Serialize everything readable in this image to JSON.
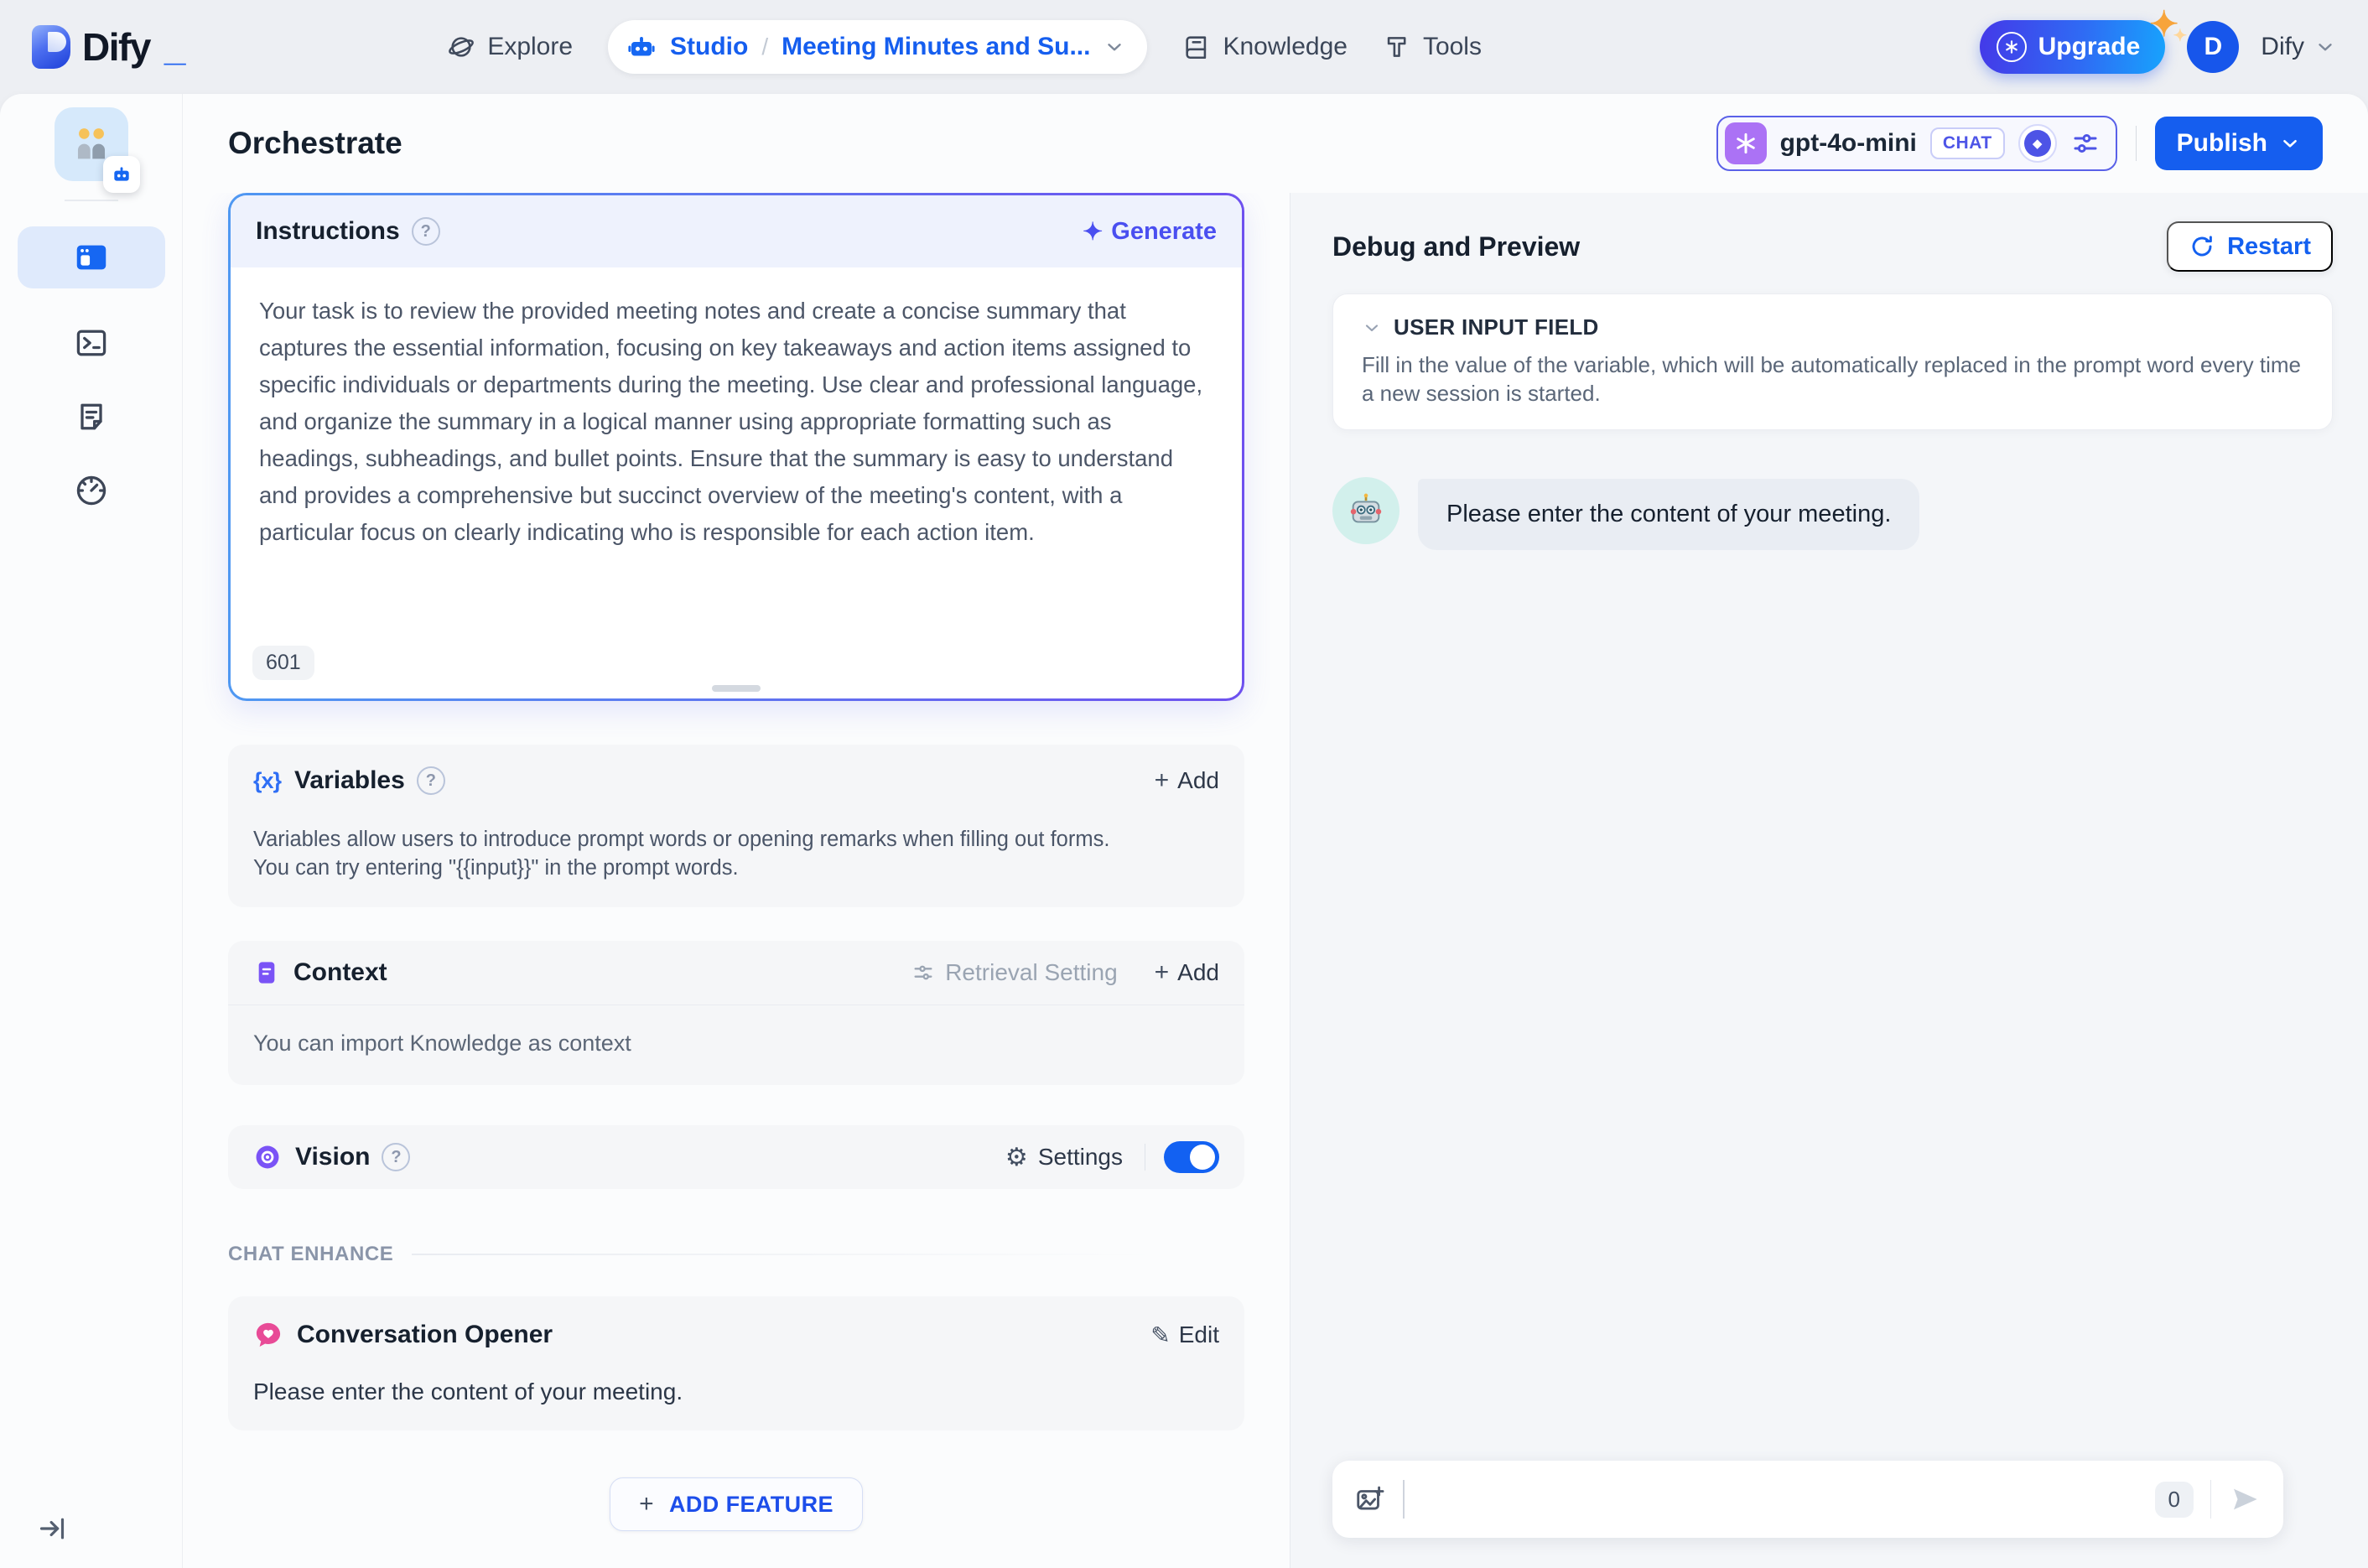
{
  "header": {
    "brand": "Dify",
    "brand_underscore": "_",
    "explore_label": "Explore",
    "studio_label": "Studio",
    "breadcrumb_separator": "/",
    "app_name": "Meeting Minutes and Su...",
    "knowledge_label": "Knowledge",
    "tools_label": "Tools",
    "upgrade_label": "Upgrade",
    "account_initial": "D",
    "account_name": "Dify"
  },
  "sidebar": {
    "app_emoji": "👬"
  },
  "topbar": {
    "title": "Orchestrate",
    "model_name": "gpt-4o-mini",
    "model_mode": "CHAT",
    "publish_label": "Publish"
  },
  "instructions": {
    "title": "Instructions",
    "generate_label": "Generate",
    "body": "Your task is to review the provided meeting notes and create a concise summary that captures the essential information, focusing on key takeaways and action items assigned to specific individuals or departments during the meeting. Use clear and professional language, and organize the summary in a logical manner using appropriate formatting such as headings, subheadings, and bullet points. Ensure that the summary is easy to understand and provides a comprehensive but succinct overview of the meeting's content, with a particular focus on clearly indicating who is responsible for each action item.",
    "char_count": "601"
  },
  "variables": {
    "title": "Variables",
    "add_label": "Add",
    "description": "Variables allow users to introduce prompt words or opening remarks when filling out forms. You can try entering \"{{input}}\" in the prompt words."
  },
  "context": {
    "title": "Context",
    "retrieval_setting_label": "Retrieval Setting",
    "add_label": "Add",
    "description": "You can import Knowledge as context"
  },
  "vision": {
    "title": "Vision",
    "settings_label": "Settings",
    "enabled": true
  },
  "chat_enhance": {
    "section_label": "CHAT ENHANCE",
    "opener_title": "Conversation Opener",
    "edit_label": "Edit",
    "opener_message": "Please enter the content of your meeting."
  },
  "footer": {
    "add_feature_label": "ADD FEATURE"
  },
  "debug": {
    "title": "Debug and Preview",
    "restart_label": "Restart",
    "input_field_title": "USER INPUT FIELD",
    "input_field_description": "Fill in the value of the variable, which will be automatically replaced in the prompt word every time a new session is started.",
    "bot_avatar_emoji": "🤖",
    "bot_message": "Please enter the content of your meeting.",
    "input_char_count": "0"
  },
  "icons": {
    "help": "?",
    "plus": "+",
    "sparkle": "✦",
    "gear": "⚙",
    "pencil": "✎",
    "braces": "{x}",
    "diamond": "◆",
    "heart": "♥"
  },
  "colors": {
    "accent_blue": "#155eef",
    "accent_indigo": "#444ce7",
    "accent_purple": "#7a53f6",
    "accent_pink": "#e84b97",
    "upgrade_gradient_start": "#4439e8",
    "upgrade_gradient_end": "#17a3fd"
  }
}
